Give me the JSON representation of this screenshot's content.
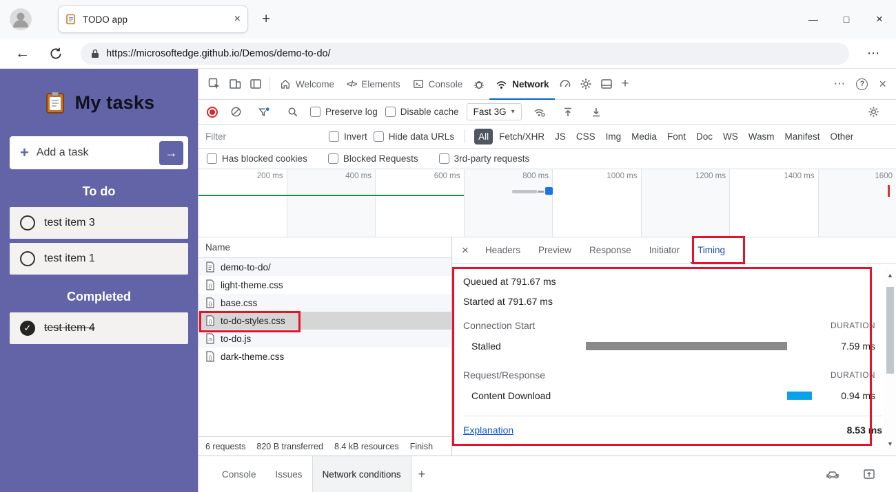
{
  "colors": {
    "accent_purple": "#6264a7",
    "annotation_red": "#e8112a",
    "timeline_green": "#1e8e3e",
    "stalled_bar": "#8a8a8a",
    "download_bar": "#0aa2e8",
    "tab_underline_blue": "#0067c0",
    "link_blue": "#0b57d0"
  },
  "icons": {
    "new_tab": "+",
    "back": "←",
    "more": "⋯",
    "help": "?",
    "close": "×",
    "minimize": "—",
    "maximize": "□",
    "caret_down": "▾",
    "scroll_up": "▲",
    "scroll_down": "▼",
    "plus": "+",
    "arrow_right": "→",
    "check": "✓",
    "elements_code": "</>"
  },
  "titlebar": {
    "tab_title": "TODO app"
  },
  "navbar": {
    "url": "https://microsoftedge.github.io/Demos/demo-to-do/"
  },
  "todo_app": {
    "title": "My tasks",
    "add_task": "Add a task",
    "todo_heading": "To do",
    "completed_heading": "Completed",
    "todo_items": [
      "test item 3",
      "test item 1"
    ],
    "completed_items": [
      "test item 4"
    ]
  },
  "devtools": {
    "panel_tabs": {
      "welcome": "Welcome",
      "elements": "Elements",
      "console": "Console",
      "network": "Network"
    },
    "toolbar": {
      "preserve_log": "Preserve log",
      "disable_cache": "Disable cache",
      "throttling_value": "Fast 3G"
    },
    "filterbar": {
      "placeholder": "Filter",
      "invert": "Invert",
      "hide_data_urls": "Hide data URLs",
      "types": [
        "All",
        "Fetch/XHR",
        "JS",
        "CSS",
        "Img",
        "Media",
        "Font",
        "Doc",
        "WS",
        "Wasm",
        "Manifest",
        "Other"
      ],
      "selected_type": "All"
    },
    "filterbar2": {
      "has_blocked_cookies": "Has blocked cookies",
      "blocked_requests": "Blocked Requests",
      "third_party": "3rd-party requests"
    },
    "timeline": {
      "labels": [
        "200 ms",
        "400 ms",
        "600 ms",
        "800 ms",
        "1000 ms",
        "1200 ms",
        "1400 ms",
        "1600"
      ]
    },
    "requests": {
      "header": "Name",
      "rows": [
        {
          "name": "demo-to-do/",
          "type": "doc"
        },
        {
          "name": "light-theme.css",
          "type": "css"
        },
        {
          "name": "base.css",
          "type": "css"
        },
        {
          "name": "to-do-styles.css",
          "type": "css",
          "selected": true
        },
        {
          "name": "to-do.js",
          "type": "js"
        },
        {
          "name": "dark-theme.css",
          "type": "css"
        }
      ]
    },
    "details": {
      "tabs": [
        "Headers",
        "Preview",
        "Response",
        "Initiator",
        "Timing"
      ],
      "selected_tab": "Timing",
      "timing": {
        "queued": "Queued at 791.67 ms",
        "started": "Started at 791.67 ms",
        "duration_header": "DURATION",
        "sections": [
          {
            "title": "Connection Start",
            "rows": [
              {
                "label": "Stalled",
                "value": "7.59 ms",
                "bar_left": "0%",
                "bar_width": "89%",
                "bar_color": "#8a8a8a"
              }
            ]
          },
          {
            "title": "Request/Response",
            "rows": [
              {
                "label": "Content Download",
                "value": "0.94 ms",
                "bar_left": "89%",
                "bar_width": "11%",
                "bar_color": "#0aa2e8"
              }
            ]
          }
        ],
        "explanation_link": "Explanation",
        "total": "8.53 ms"
      }
    },
    "statusbar": {
      "items": [
        "6 requests",
        "820 B transferred",
        "8.4 kB resources",
        "Finish"
      ]
    },
    "drawer": {
      "tabs": [
        "Console",
        "Issues",
        "Network conditions"
      ],
      "selected": "Network conditions"
    }
  }
}
